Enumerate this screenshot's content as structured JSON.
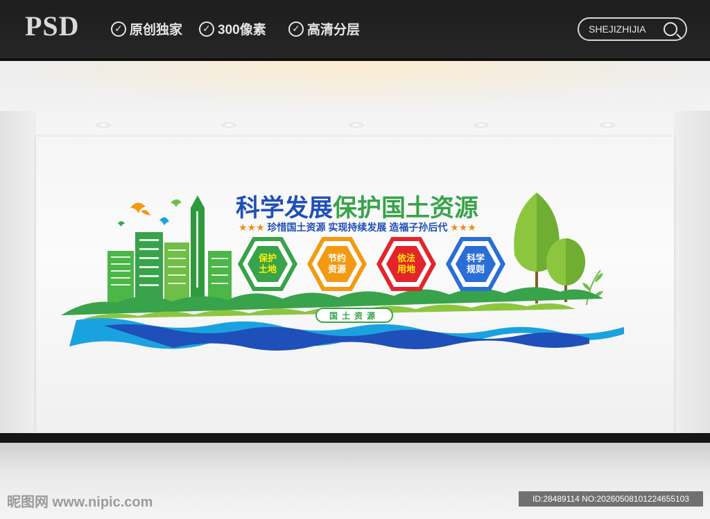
{
  "header": {
    "brand": "PSD",
    "features": [
      "原创独家",
      "300像素",
      "高清分层"
    ],
    "search_label": "SHEJIZHIJIA"
  },
  "mural": {
    "title_part1": "科学发展",
    "title_part2": "保护国土资源",
    "subtitle": "珍惜国土资源  实现持续发展  造福子孙后代",
    "subtitle_stars": "★★★",
    "hexagons": [
      {
        "line1": "保护",
        "line2": "土地",
        "color": "#38a34a"
      },
      {
        "line1": "节约",
        "line2": "资源",
        "color": "#f39a12"
      },
      {
        "line1": "依法",
        "line2": "用地",
        "color": "#e3242b"
      },
      {
        "line1": "科学",
        "line2": "规则",
        "color": "#2a6ed6"
      }
    ],
    "badge": "国土资源",
    "colors": {
      "green": "#38a34a",
      "light_green": "#8cc63f",
      "blue": "#1f4fb8",
      "water": "#1aa2e0"
    }
  },
  "footer": {
    "watermark": "昵图网 www.nipic.com",
    "id_text": "ID:28489114 NO:20260508101224655103"
  }
}
